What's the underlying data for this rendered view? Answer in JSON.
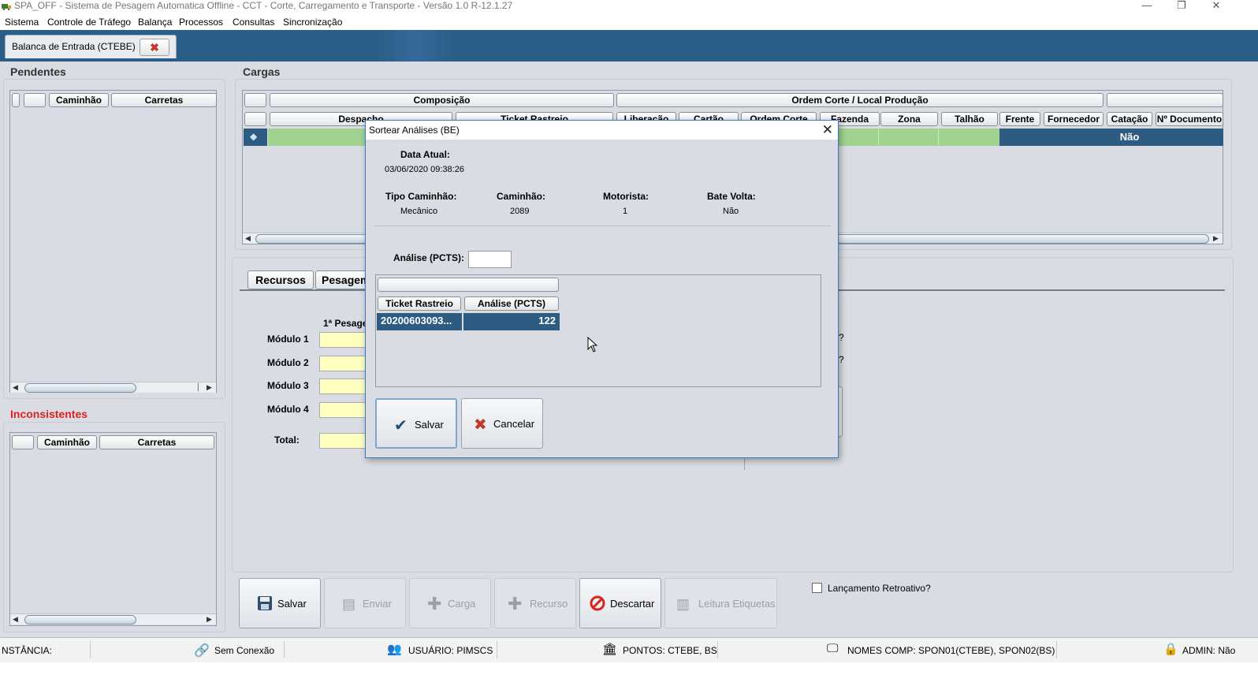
{
  "window": {
    "title": "SPA_OFF - Sistema de Pesagem Automatica Offline - CCT - Corte, Carregamento e Transporte - Versão 1.0 R-12.1.27"
  },
  "menu": [
    "Sistema",
    "Controle de Tráfego",
    "Balança",
    "Processos",
    "Consultas",
    "Sincronização"
  ],
  "tab": {
    "label": "Balanca de Entrada (CTEBE)"
  },
  "pendentes": {
    "title": "Pendentes",
    "columns": [
      "Caminhão",
      "Carretas"
    ]
  },
  "inconsistentes": {
    "title": "Inconsistentes",
    "columns": [
      "Caminhão",
      "Carretas"
    ]
  },
  "cargas": {
    "title": "Cargas",
    "group_headers": [
      "Composição",
      "Ordem Corte / Local Produção"
    ],
    "columns": [
      "Despacho",
      "Ticket Rastreio",
      "Liberação",
      "Cartão",
      "Ordem Corte",
      "Fazenda",
      "Zona",
      "Talhão",
      "Frente",
      "Fornecedor",
      "Catação",
      "Nº Documento"
    ],
    "row_catacao": "Não"
  },
  "bottom_tabs": [
    "Recursos",
    "Pesagem"
  ],
  "pesagem": {
    "col_header": "1ª Pesage",
    "rows": [
      "Módulo 1",
      "Módulo 2",
      "Módulo 3",
      "Módulo 4"
    ],
    "total_label": "Total:",
    "partial_q1": "?",
    "partial_q2": "?"
  },
  "actions": {
    "salvar": "Salvar",
    "enviar": "Enviar",
    "carga": "Carga",
    "recurso": "Recurso",
    "descartar": "Descartar",
    "leitura": "Leitura Etiquetas",
    "retroativo": "Lançamento Retroativo?"
  },
  "status": {
    "instancia": "NSTÂNCIA:",
    "conexao": "Sem Conexão",
    "usuario": "USUÁRIO: PIMSCS",
    "pontos": "PONTOS: CTEBE, BS",
    "nomes": "NOMES COMP: SPON01(CTEBE), SPON02(BS)",
    "admin": "ADMIN: Não"
  },
  "dialog": {
    "title": "Sortear Análises (BE)",
    "data_atual_label": "Data Atual:",
    "data_atual": "03/06/2020 09:38:26",
    "tipo_label": "Tipo Caminhão:",
    "tipo": "Mecânico",
    "caminhao_label": "Caminhão:",
    "caminhao": "2089",
    "motorista_label": "Motorista:",
    "motorista": "1",
    "bate_label": "Bate Volta:",
    "bate": "Não",
    "analise_label": "Análise (PCTS):",
    "analise_value": "",
    "columns": [
      "Ticket Rastreio",
      "Análise (PCTS)"
    ],
    "row": {
      "ticket": "20200603093...",
      "analise": "122"
    },
    "salvar": "Salvar",
    "cancelar": "Cancelar"
  },
  "colors": {
    "tab_strip": "#2b5e87",
    "selection": "#2d5b82",
    "green_row": "#9fd38f",
    "field_yellow": "#ffffc0",
    "alert_red": "#e0201c"
  }
}
